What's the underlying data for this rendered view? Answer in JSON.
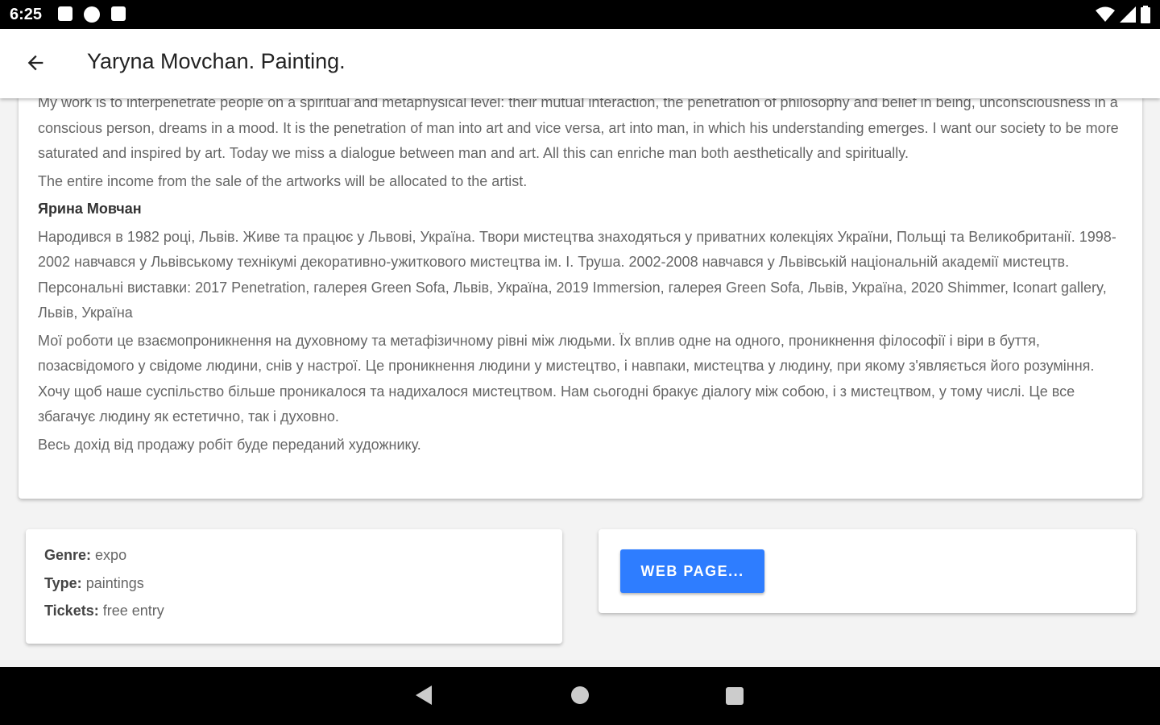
{
  "status_bar": {
    "time": "6:25"
  },
  "app_bar": {
    "title": "Yaryna Movchan. Painting."
  },
  "description": {
    "paragraphs_en": [
      "My work is to interpenetrate people on a spiritual and metaphysical level: their mutual interaction, the penetration of philosophy and belief in being, unconsciousness in a conscious person, dreams in a mood. It is the penetration of man into art and vice versa, art into man, in which his understanding emerges. I want our society to be more saturated and inspired by art. Today we miss a dialogue between man and art. All this can enriche man both aesthetically and spiritually.",
      "The entire income from the sale of the artworks will be allocated to the artist."
    ],
    "heading_ua": "Ярина Мовчан",
    "paragraphs_ua": [
      "Народився в 1982 році, Львів. Живе та працює у Львові, Україна. Твори мистецтва знаходяться у приватних колекціях України, Польщі та Великобританії. 1998-2002 навчався у Львівському технікумі декоративно-ужиткового мистецтва ім. І. Труша. 2002-2008 навчався у Львівській національній академії мистецтв. Персональні виставки: 2017 Penetration, галерея Green Sofa, Львів, Україна, 2019 Immersion, галерея Green Sofa, Львів, Україна, 2020 Shimmer, Iconart gallery, Львів, Україна",
      "Мої роботи це взаємопроникнення на духовному та метафізичному рівні між людьми. Їх вплив одне на одного, проникнення філософії і віри в буття, позасвідомого у свідоме людини, снів у настрої. Це проникнення людини у мистецтво, і навпаки, мистецтва у людину, при якому з'являється його розуміння.  Хочу щоб наше суспільство більше проникалося та надихалося мистецтвом. Нам сьогодні бракує діалогу між собою, і з мистецтвом, у тому числі. Це все збагачує людину як естетично, так і духовно.",
      "Весь дохід від продажу робіт буде переданий художнику."
    ]
  },
  "info": {
    "genre_label": "Genre:",
    "genre_value": "expo",
    "type_label": "Type:",
    "type_value": "paintings",
    "tickets_label": "Tickets:",
    "tickets_value": "free entry"
  },
  "web_button": {
    "label": "WEB PAGE..."
  },
  "colors": {
    "accent": "#2e7dff",
    "background": "#f3f3f3"
  },
  "icons": {
    "back": "arrow-left-icon",
    "nav_back": "triangle-back-icon",
    "nav_home": "circle-home-icon",
    "nav_recents": "square-recents-icon"
  }
}
